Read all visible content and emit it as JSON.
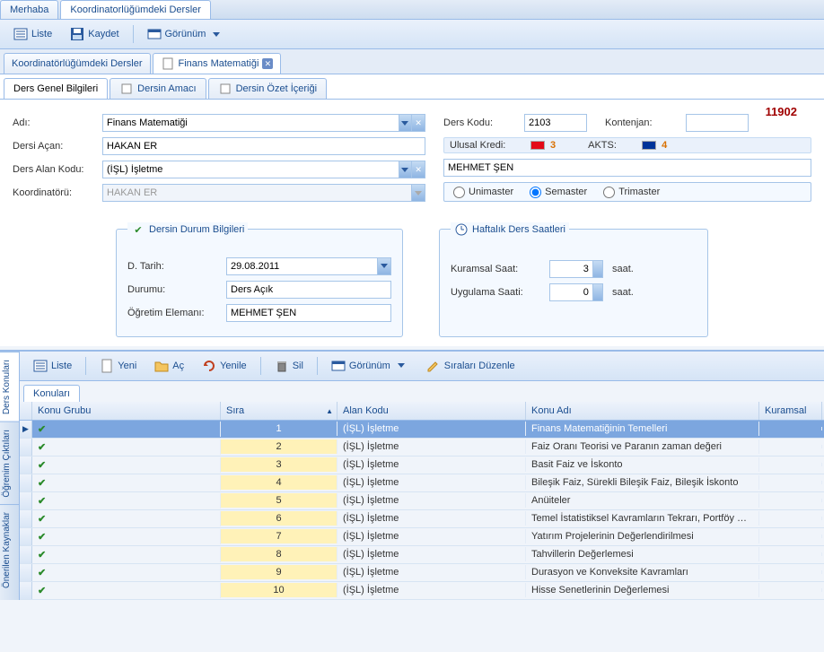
{
  "topTabs": {
    "merhaba": "Merhaba",
    "koord": "Koordinatorlüğümdeki Dersler"
  },
  "toolbar1": {
    "liste": "Liste",
    "kaydet": "Kaydet",
    "gorunum": "Görünüm"
  },
  "subtabs": {
    "koord": "Koordinatörlüğümdeki Dersler",
    "finans": "Finans Matematiği"
  },
  "detailTabs": {
    "genel": "Ders Genel Bilgileri",
    "amac": "Dersin Amacı",
    "ozet": "Dersin Özet İçeriği"
  },
  "form": {
    "idBadge": "11902",
    "adi_label": "Adı:",
    "adi_value": "Finans Matematiği",
    "dersiAcan_label": "Dersi Açan:",
    "dersiAcan_value": "HAKAN ER",
    "dersAlanKodu_label": "Ders Alan Kodu:",
    "dersAlanKodu_value": "(İŞL) İşletme",
    "koordinatoru_label": "Koordinatörü:",
    "koordinatoru_value": "HAKAN ER",
    "dersKodu_label": "Ders Kodu:",
    "dersKodu_value": "2103",
    "kontenjan_label": "Kontenjan:",
    "kontenjan_value": "",
    "ulusalKredi_label": "Ulusal Kredi:",
    "ulusalKredi_value": "3",
    "akts_label": "AKTS:",
    "akts_value": "4",
    "danisman_value": "MEHMET ŞEN",
    "radio": {
      "uni": "Unimaster",
      "sem": "Semaster",
      "tri": "Trimaster"
    }
  },
  "durum": {
    "title": "Dersin Durum Bilgileri",
    "dtarih_label": "D. Tarih:",
    "dtarih_value": "29.08.2011",
    "durumu_label": "Durumu:",
    "durumu_value": "Ders Açık",
    "ogretim_label": "Öğretim Elemanı:",
    "ogretim_value": "MEHMET ŞEN"
  },
  "haftalik": {
    "title": "Haftalık Ders Saatleri",
    "kuramsal_label": "Kuramsal Saat:",
    "kuramsal_value": "3",
    "uygulama_label": "Uygulama Saati:",
    "uygulama_value": "0",
    "saat": "saat."
  },
  "toolbar2": {
    "liste": "Liste",
    "yeni": "Yeni",
    "ac": "Aç",
    "yenile": "Yenile",
    "sil": "Sil",
    "gorunum": "Görünüm",
    "sirala": "Sıraları Düzenle"
  },
  "sideTabs": {
    "ders": "Ders Konuları",
    "ogrenim": "Öğrenim Çıktıları",
    "onerilen": "Önerilen Kaynaklar"
  },
  "konulariTab": "Konuları",
  "gridHead": {
    "konuGrubu": "Konu Grubu",
    "sira": "Sıra",
    "alanKodu": "Alan Kodu",
    "konuAdi": "Konu Adı",
    "kuramsal": "Kuramsal"
  },
  "rows": [
    {
      "sira": "1",
      "alan": "(İŞL) İşletme",
      "konu": "Finans Matematiğinin Temelleri"
    },
    {
      "sira": "2",
      "alan": "(İŞL) İşletme",
      "konu": "Faiz Oranı Teorisi ve Paranın zaman değeri"
    },
    {
      "sira": "3",
      "alan": "(İŞL) İşletme",
      "konu": "Basit Faiz ve İskonto"
    },
    {
      "sira": "4",
      "alan": "(İŞL) İşletme",
      "konu": "Bileşik Faiz, Sürekli Bileşik Faiz, Bileşik İskonto"
    },
    {
      "sira": "5",
      "alan": "(İŞL) İşletme",
      "konu": "Anüiteler"
    },
    {
      "sira": "6",
      "alan": "(İŞL) İşletme",
      "konu": "Temel İstatistiksel Kavramların Tekrarı, Portföy Mate..."
    },
    {
      "sira": "7",
      "alan": "(İŞL) İşletme",
      "konu": "Yatırım Projelerinin Değerlendirilmesi"
    },
    {
      "sira": "8",
      "alan": "(İŞL) İşletme",
      "konu": "Tahvillerin Değerlemesi"
    },
    {
      "sira": "9",
      "alan": "(İŞL) İşletme",
      "konu": "Durasyon ve Konveksite Kavramları"
    },
    {
      "sira": "10",
      "alan": "(İŞL) İşletme",
      "konu": "Hisse Senetlerinin Değerlemesi"
    }
  ]
}
